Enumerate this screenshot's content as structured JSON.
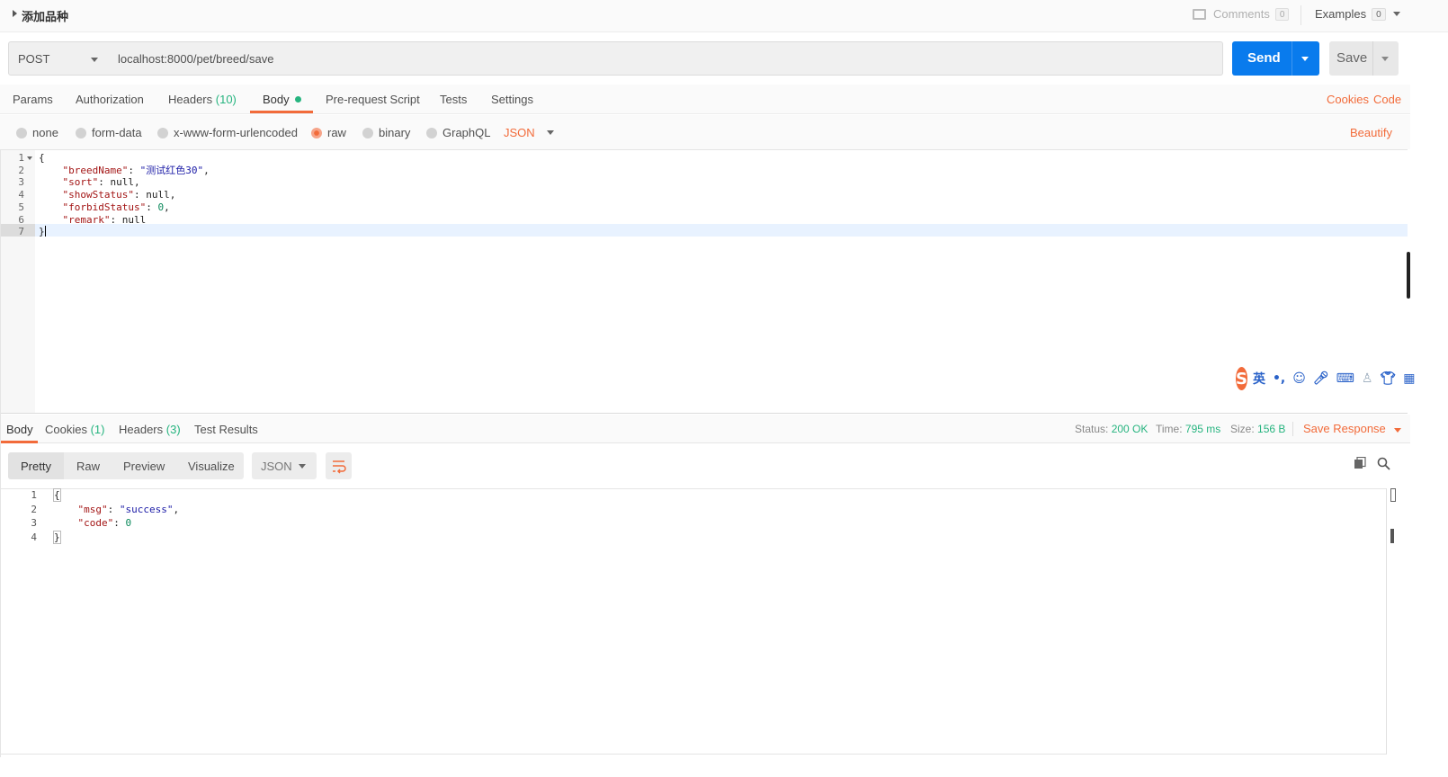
{
  "title": "添加品种",
  "comments": {
    "label": "Comments",
    "count": "0"
  },
  "examples": {
    "label": "Examples",
    "count": "0"
  },
  "request": {
    "method": "POST",
    "url": "localhost:8000/pet/breed/save",
    "send_label": "Send",
    "save_label": "Save"
  },
  "request_tabs": {
    "params": "Params",
    "authorization": "Authorization",
    "headers": "Headers",
    "headers_count": "(10)",
    "body": "Body",
    "pre_request": "Pre-request Script",
    "tests": "Tests",
    "settings": "Settings",
    "cookies": "Cookies",
    "code": "Code"
  },
  "body_options": {
    "none": "none",
    "form_data": "form-data",
    "urlencoded": "x-www-form-urlencoded",
    "raw": "raw",
    "binary": "binary",
    "graphql": "GraphQL",
    "format": "JSON",
    "beautify": "Beautify",
    "selected": "raw"
  },
  "request_body_lines": [
    {
      "n": "1",
      "text": "{"
    },
    {
      "n": "2",
      "key": "\"breedName\"",
      "sep": ": ",
      "val": "\"测试红色30\"",
      "tail": ","
    },
    {
      "n": "3",
      "key": "\"sort\"",
      "sep": ": ",
      "val": "null",
      "tail": ","
    },
    {
      "n": "4",
      "key": "\"showStatus\"",
      "sep": ": ",
      "val": "null",
      "tail": ","
    },
    {
      "n": "5",
      "key": "\"forbidStatus\"",
      "sep": ": ",
      "val": "0",
      "tail": ","
    },
    {
      "n": "6",
      "key": "\"remark\"",
      "sep": ": ",
      "val": "null",
      "tail": ""
    },
    {
      "n": "7",
      "text": "}"
    }
  ],
  "ime": {
    "logo": "S",
    "mode": "英",
    "punct": "•,"
  },
  "response_tabs": {
    "body": "Body",
    "cookies": "Cookies",
    "cookies_count": "(1)",
    "headers": "Headers",
    "headers_count": "(3)",
    "test_results": "Test Results"
  },
  "response_status": {
    "status_label": "Status:",
    "status_value": "200 OK",
    "time_label": "Time:",
    "time_value": "795 ms",
    "size_label": "Size:",
    "size_value": "156 B",
    "save_response": "Save Response"
  },
  "response_view": {
    "pretty": "Pretty",
    "raw": "Raw",
    "preview": "Preview",
    "visualize": "Visualize",
    "format": "JSON"
  },
  "response_body_lines": [
    {
      "n": "1",
      "text": "{"
    },
    {
      "n": "2",
      "key": "\"msg\"",
      "sep": ": ",
      "val": "\"success\"",
      "tail": ","
    },
    {
      "n": "3",
      "key": "\"code\"",
      "sep": ": ",
      "val": "0",
      "tail": ""
    },
    {
      "n": "4",
      "text": "}"
    }
  ],
  "colors": {
    "accent": "#f26b3a",
    "send": "#097bed",
    "success": "#26b47f"
  }
}
